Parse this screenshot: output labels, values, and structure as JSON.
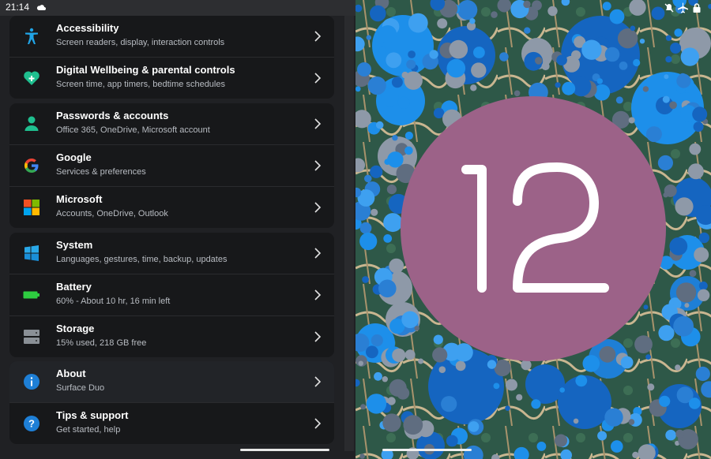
{
  "status_bar": {
    "time": "21:14"
  },
  "settings": {
    "groups": [
      [
        {
          "title": "Accessibility",
          "subtitle": "Screen readers, display, interaction controls",
          "icon": "accessibility-icon"
        },
        {
          "title": "Digital Wellbeing & parental controls",
          "subtitle": "Screen time, app timers, bedtime schedules",
          "icon": "wellbeing-icon"
        }
      ],
      [
        {
          "title": "Passwords & accounts",
          "subtitle": "Office 365, OneDrive, Microsoft account",
          "icon": "account-icon"
        },
        {
          "title": "Google",
          "subtitle": "Services & preferences",
          "icon": "google-icon"
        },
        {
          "title": "Microsoft",
          "subtitle": "Accounts, OneDrive, Outlook",
          "icon": "microsoft-icon"
        }
      ],
      [
        {
          "title": "System",
          "subtitle": "Languages, gestures, time, backup, updates",
          "icon": "windows-system-icon"
        },
        {
          "title": "Battery",
          "subtitle": "60% - About 10 hr, 16 min left",
          "icon": "battery-icon"
        },
        {
          "title": "Storage",
          "subtitle": "15% used, 218 GB free",
          "icon": "storage-icon"
        }
      ],
      [
        {
          "title": "About",
          "subtitle": "Surface Duo",
          "icon": "info-icon"
        },
        {
          "title": "Tips & support",
          "subtitle": "Get started, help",
          "icon": "help-icon"
        }
      ]
    ]
  },
  "wallpaper": {
    "number": "12",
    "disc_color": "#9c6288"
  },
  "colors": {
    "accent_blue": "#1e7fd6",
    "card_bg": "#17181a",
    "pane_bg": "#202124"
  }
}
